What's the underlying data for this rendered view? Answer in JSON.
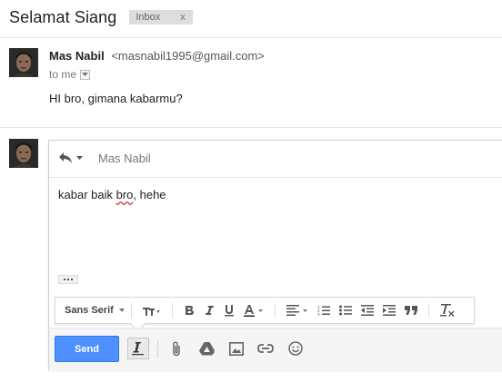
{
  "thread": {
    "subject": "Selamat Siang",
    "label": "Inbox",
    "label_remove": "x"
  },
  "message": {
    "sender_name": "Mas Nabil",
    "sender_email": "<masnabil1995@gmail.com>",
    "to_text": "to me",
    "body": "HI bro, gimana kabarmu?"
  },
  "compose": {
    "recipient": "Mas Nabil",
    "text_before": "kabar baik ",
    "text_misspelled": "bro",
    "text_after": ", hehe",
    "font_name": "Sans Serif",
    "send_label": "Send"
  },
  "colors": {
    "send_button": "#4d90fe",
    "label_chip": "#dddddd"
  },
  "icons": [
    "reply-icon",
    "chevron-down-icon",
    "text-size-icon",
    "bold-icon",
    "italic-icon",
    "underline-icon",
    "text-color-icon",
    "align-icon",
    "numbered-list-icon",
    "bulleted-list-icon",
    "indent-less-icon",
    "indent-more-icon",
    "quote-icon",
    "remove-formatting-icon",
    "formatting-options-icon",
    "attach-icon",
    "drive-icon",
    "insert-photo-icon",
    "insert-link-icon",
    "emoji-icon"
  ]
}
